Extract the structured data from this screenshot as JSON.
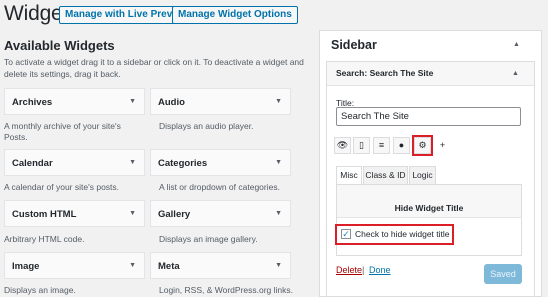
{
  "header": {
    "title": "Widgets",
    "manage_live_preview": "Manage with Live Preview",
    "manage_widget_options": "Manage Widget Options"
  },
  "available": {
    "title": "Available Widgets",
    "description": "To activate a widget drag it to a sidebar or click on it. To deactivate a widget and delete its settings, drag it back.",
    "widgets": [
      {
        "label": "Archives",
        "desc": "A monthly archive of your site's Posts."
      },
      {
        "label": "Audio",
        "desc": "Displays an audio player."
      },
      {
        "label": "Calendar",
        "desc": "A calendar of your site's posts."
      },
      {
        "label": "Categories",
        "desc": "A list or dropdown of categories."
      },
      {
        "label": "Custom HTML",
        "desc": "Arbitrary HTML code."
      },
      {
        "label": "Gallery",
        "desc": "Displays an image gallery."
      },
      {
        "label": "Image",
        "desc": "Displays an image."
      },
      {
        "label": "Meta",
        "desc": "Login, RSS, & WordPress.org links."
      }
    ],
    "arrow_glyph": "▼"
  },
  "sidebar": {
    "title": "Sidebar",
    "arrow_glyph": "▲",
    "search_widget": {
      "header_prefix": "Search:",
      "header_title": "Search The Site",
      "title_label": "Title:",
      "title_value": "Search The Site",
      "icon_buttons": [
        {
          "name": "eye-icon",
          "glyph": "👁"
        },
        {
          "name": "mobile-icon",
          "glyph": "▯"
        },
        {
          "name": "align-icon",
          "glyph": "≡"
        },
        {
          "name": "user-icon",
          "glyph": "●"
        },
        {
          "name": "gear-icon",
          "glyph": "⚙"
        },
        {
          "name": "plus-icon",
          "glyph": "+"
        }
      ],
      "tabs": [
        "Misc",
        "Class & ID",
        "Logic"
      ],
      "active_tab": "Misc",
      "hide_title_heading": "Hide Widget Title",
      "checkbox_label": "Check to hide widget title",
      "checkbox_checked": true,
      "delete_label": "Delete",
      "separator": "|",
      "done_label": "Done",
      "saved_label": "Saved"
    }
  },
  "colors": {
    "accent": "#0073aa",
    "highlight": "#dc1f26",
    "delete": "#a00000",
    "saved_button": "#7fb9d9"
  }
}
